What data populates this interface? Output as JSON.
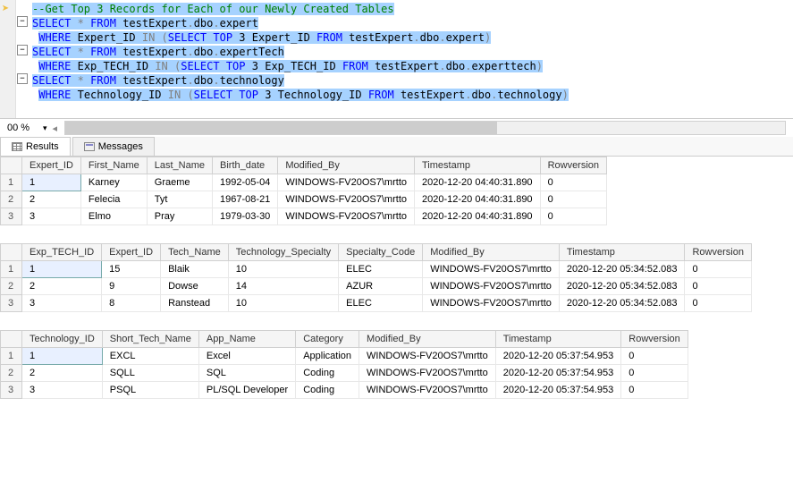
{
  "editor": {
    "lines": [
      {
        "type": "comment",
        "text": "--Get Top 3 Records for Each of our Newly Created Tables"
      },
      {
        "type": "sql1a",
        "indent": 0
      },
      {
        "type": "sql1b",
        "indent": 1
      },
      {
        "type": "sql2a",
        "indent": 0
      },
      {
        "type": "sql2b",
        "indent": 1
      },
      {
        "type": "sql3a",
        "indent": 0
      },
      {
        "type": "sql3b",
        "indent": 1
      }
    ],
    "sql": {
      "select": "SELECT",
      "star": "*",
      "from": "FROM",
      "where": "WHERE",
      "in": "IN",
      "top": "TOP",
      "three": "3",
      "t1": "testExpert",
      "dbo": "dbo",
      "exp": "expert",
      "et": "expertTech",
      "ett": "experttech",
      "tech": "technology",
      "expId": "Expert_ID",
      "etId": "Exp_TECH_ID",
      "techId": "Technology_ID"
    }
  },
  "zoom": "00 %",
  "tabs": {
    "results": "Results",
    "messages": "Messages"
  },
  "grid1": {
    "headers": [
      "Expert_ID",
      "First_Name",
      "Last_Name",
      "Birth_date",
      "Modified_By",
      "Timestamp",
      "Rowversion"
    ],
    "rows": [
      [
        "1",
        "Karney",
        "Graeme",
        "1992-05-04",
        "WINDOWS-FV20OS7\\mrtto",
        "2020-12-20 04:40:31.890",
        "0"
      ],
      [
        "2",
        "Felecia",
        "Tyt",
        "1967-08-21",
        "WINDOWS-FV20OS7\\mrtto",
        "2020-12-20 04:40:31.890",
        "0"
      ],
      [
        "3",
        "Elmo",
        "Pray",
        "1979-03-30",
        "WINDOWS-FV20OS7\\mrtto",
        "2020-12-20 04:40:31.890",
        "0"
      ]
    ]
  },
  "grid2": {
    "headers": [
      "Exp_TECH_ID",
      "Expert_ID",
      "Tech_Name",
      "Technology_Specialty",
      "Specialty_Code",
      "Modified_By",
      "Timestamp",
      "Rowversion"
    ],
    "rows": [
      [
        "1",
        "15",
        "Blaik",
        "10",
        "ELEC",
        "WINDOWS-FV20OS7\\mrtto",
        "2020-12-20 05:34:52.083",
        "0"
      ],
      [
        "2",
        "9",
        "Dowse",
        "14",
        "AZUR",
        "WINDOWS-FV20OS7\\mrtto",
        "2020-12-20 05:34:52.083",
        "0"
      ],
      [
        "3",
        "8",
        "Ranstead",
        "10",
        "ELEC",
        "WINDOWS-FV20OS7\\mrtto",
        "2020-12-20 05:34:52.083",
        "0"
      ]
    ]
  },
  "grid3": {
    "headers": [
      "Technology_ID",
      "Short_Tech_Name",
      "App_Name",
      "Category",
      "Modified_By",
      "Timestamp",
      "Rowversion"
    ],
    "rows": [
      [
        "1",
        "EXCL",
        "Excel",
        "Application",
        "WINDOWS-FV20OS7\\mrtto",
        "2020-12-20 05:37:54.953",
        "0"
      ],
      [
        "2",
        "SQLL",
        "SQL",
        "Coding",
        "WINDOWS-FV20OS7\\mrtto",
        "2020-12-20 05:37:54.953",
        "0"
      ],
      [
        "3",
        "PSQL",
        "PL/SQL Developer",
        "Coding",
        "WINDOWS-FV20OS7\\mrtto",
        "2020-12-20 05:37:54.953",
        "0"
      ]
    ]
  }
}
